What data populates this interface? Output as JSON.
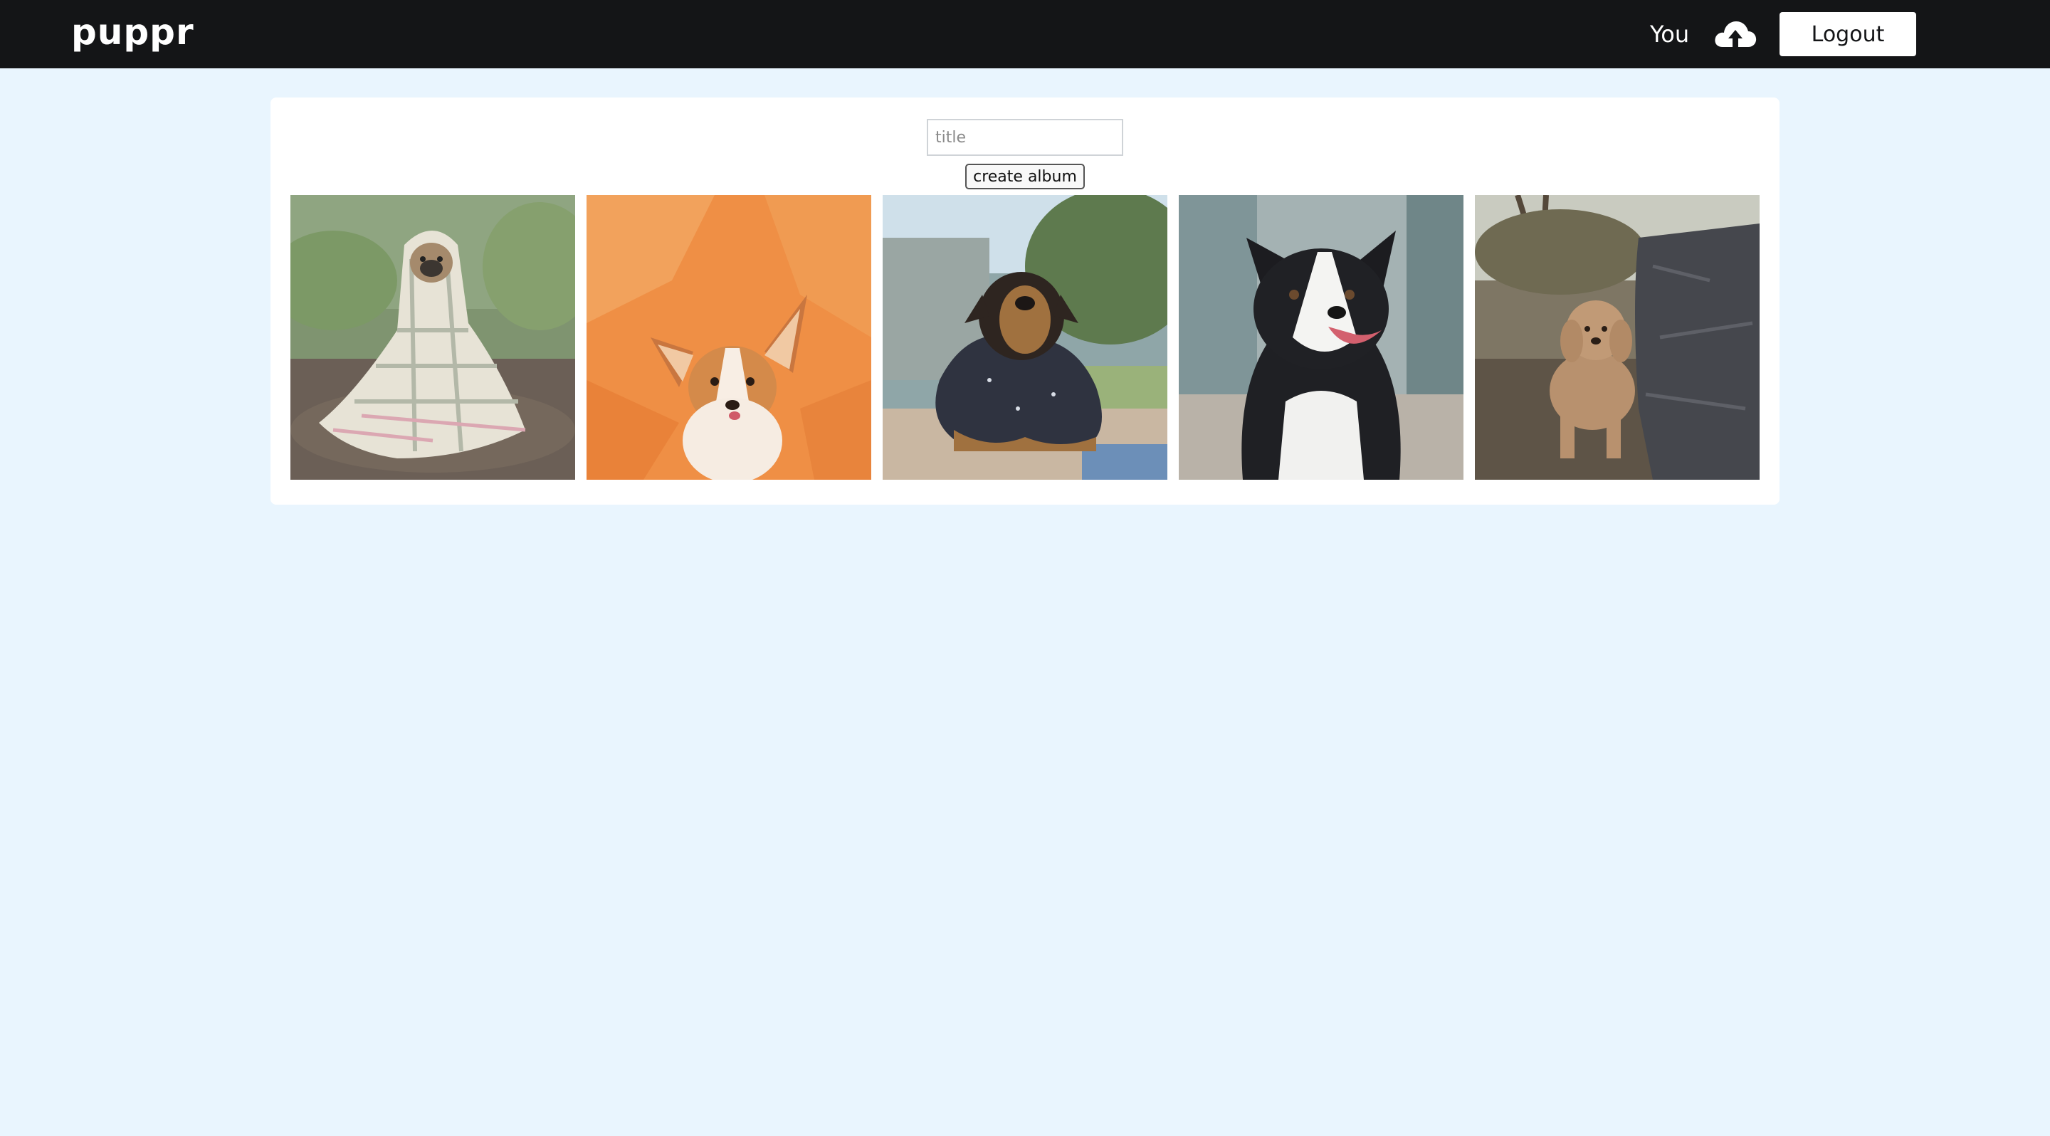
{
  "app": {
    "logo": "puppr"
  },
  "nav": {
    "you_label": "You",
    "upload_icon": "cloud-upload-icon",
    "logout_label": "Logout"
  },
  "album_form": {
    "title_placeholder": "title",
    "title_value": "",
    "create_label": "create album"
  },
  "photos": [
    {
      "subject": "pug wrapped in plaid blanket"
    },
    {
      "subject": "corgi puppy on orange background"
    },
    {
      "subject": "rottweiler puppy in dark coat"
    },
    {
      "subject": "border collie"
    },
    {
      "subject": "apricot poodle by stone wall"
    }
  ],
  "colors": {
    "nav_bg": "#141517",
    "page_bg": "#e9f5fe",
    "panel_bg": "#ffffff"
  }
}
